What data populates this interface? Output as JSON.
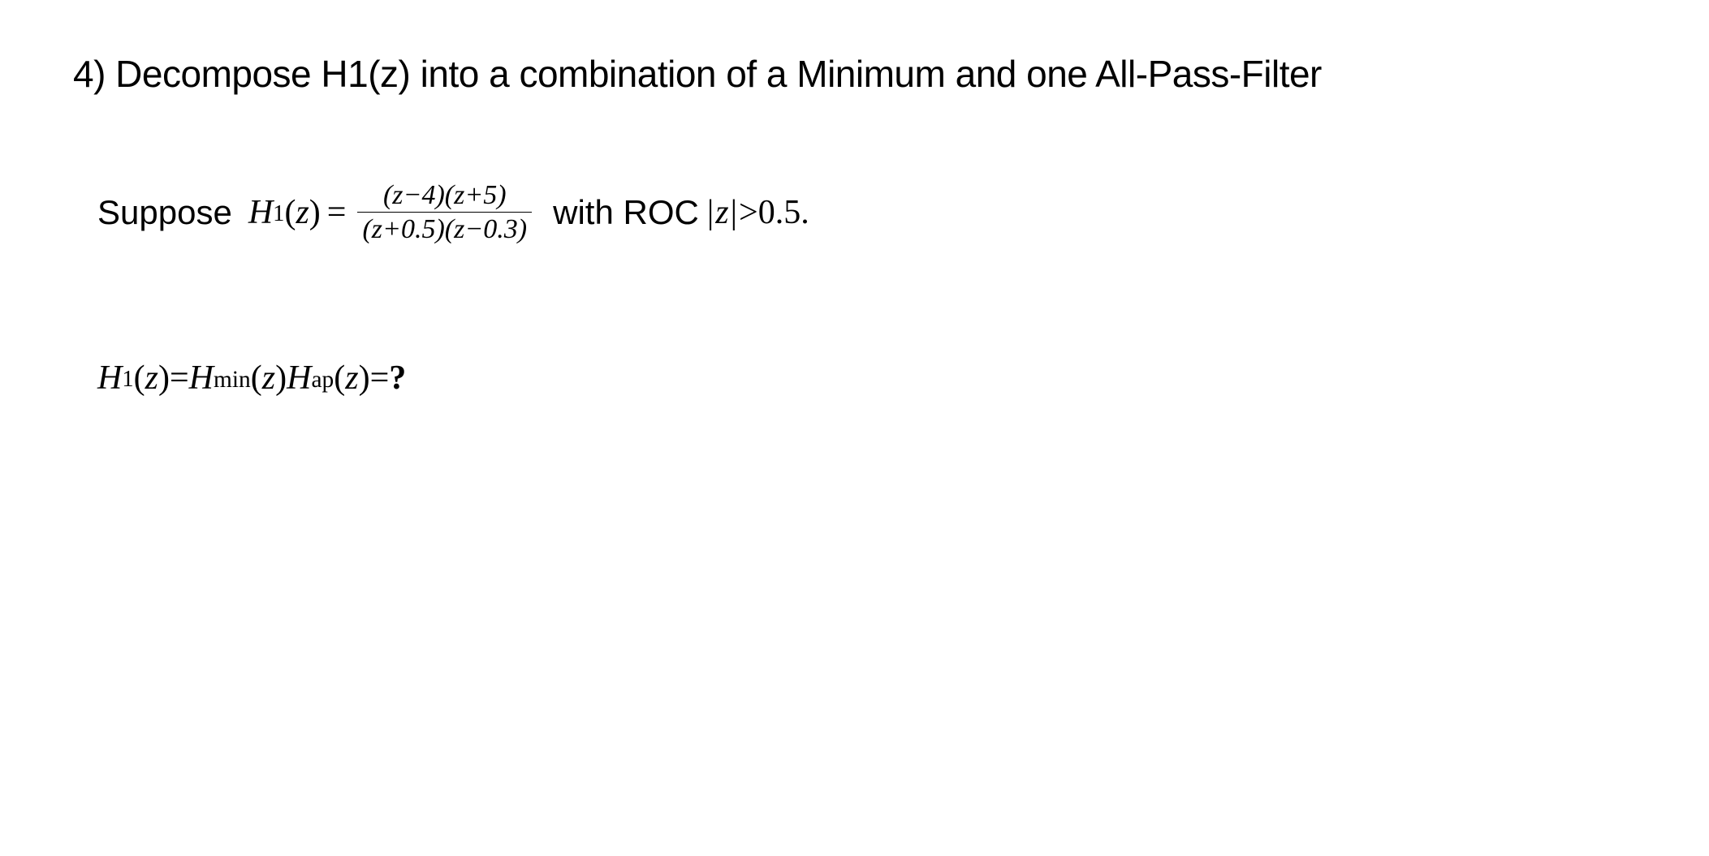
{
  "problem": {
    "title": "4) Decompose H1(z) into a combination of a  Minimum and one  All-Pass-Filter"
  },
  "line1": {
    "prefix": "Suppose ",
    "H": "H",
    "sub1": "1",
    "arg_open": "(",
    "z": "z",
    "arg_close": ")",
    "equals": " = ",
    "frac_num": "(z−4)(z+5)",
    "frac_den": "(z+0.5)(z−0.3)",
    "with_roc": " with ROC ",
    "abs_left": "|",
    "abs_z": "z",
    "abs_right": "|",
    "gt": " > ",
    "roc_val": "0.5",
    "period": "."
  },
  "line2": {
    "H": "H",
    "sub1": "1",
    "arg_open": "(",
    "z": "z",
    "arg_close": ")",
    "eq1": " = ",
    "Hmin_H": "H",
    "Hmin_sub": "min",
    "Hap_H": "H",
    "Hap_sub": "ap",
    "eq2": " = ",
    "question": "?"
  }
}
